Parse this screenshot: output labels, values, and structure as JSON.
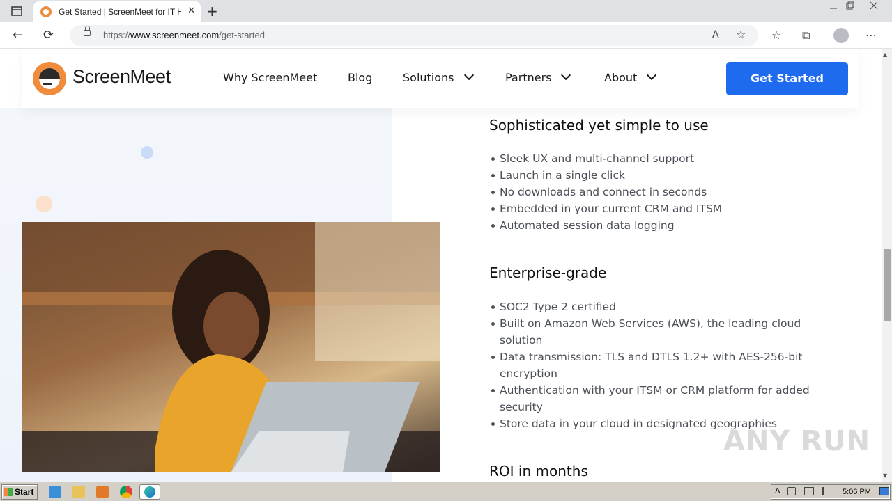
{
  "browser": {
    "tab_title": "Get Started | ScreenMeet for IT H",
    "tab_close": "✕",
    "new_tab": "+",
    "url_prefix": "https://",
    "url_host": "www.screenmeet.com",
    "url_path": "/get-started"
  },
  "header": {
    "logo_text": "ScreenMeet",
    "nav": {
      "why": "Why ScreenMeet",
      "blog": "Blog",
      "solutions": "Solutions",
      "partners": "Partners",
      "about": "About"
    },
    "cta_label": "Get Started"
  },
  "sections": {
    "simple": {
      "title": "Sophisticated yet simple to use",
      "items": [
        "Sleek UX and multi-channel support",
        "Launch in a single click",
        "No downloads and connect in seconds",
        "Embedded in your current CRM and ITSM",
        "Automated session data logging"
      ]
    },
    "enterprise": {
      "title": "Enterprise-grade",
      "items": [
        "SOC2 Type 2 certified",
        "Built on Amazon Web Services (AWS), the leading cloud solution",
        "Data transmission: TLS and DTLS 1.2+ with AES-256-bit encryption",
        "Authentication with your ITSM or CRM platform for added security",
        "Store data in your cloud in designated geographies"
      ]
    },
    "roi": {
      "title": "ROI in months"
    }
  },
  "watermark": "ANY RUN",
  "taskbar": {
    "start_label": "Start",
    "clock": "5:06 PM"
  },
  "colors": {
    "brand_orange": "#f08c3c",
    "cta_blue": "#1f6bf0"
  },
  "icons": {
    "back": "←",
    "reload": "⟳",
    "read_aloud": "A",
    "favorite_add": "☆",
    "favorites": "☆",
    "collections": "⧉",
    "menu": "⋯",
    "scroll_up": "▲",
    "scroll_down": "▼"
  }
}
